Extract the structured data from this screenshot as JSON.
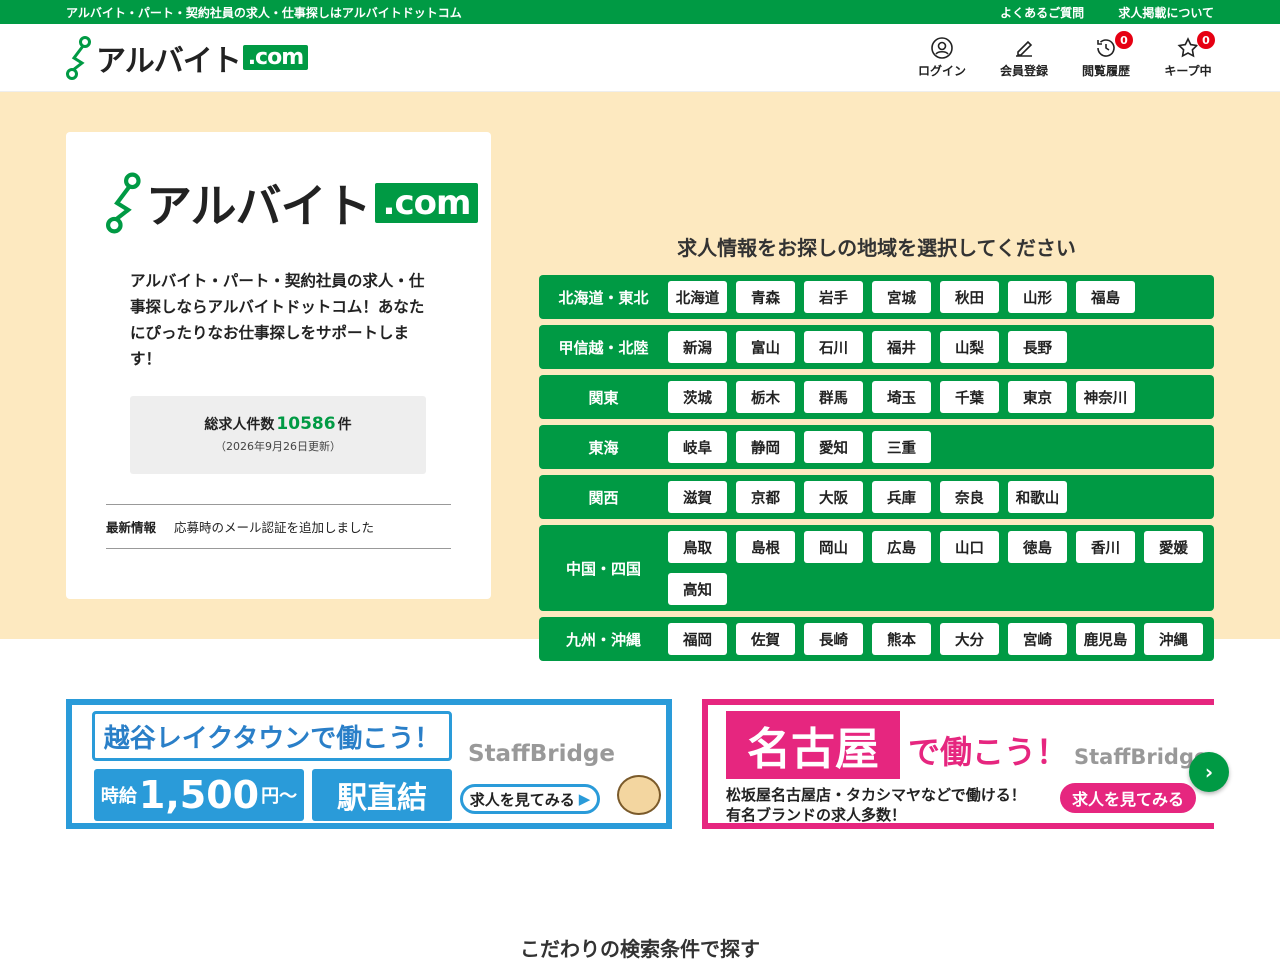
{
  "topbar": {
    "tagline": "アルバイト・パート・契約社員の求人・仕事探しはアルバイトドットコム",
    "links": [
      "よくあるご質問",
      "求人掲載について"
    ]
  },
  "header": {
    "logo_text": "アルバイト",
    "logo_com": ".com",
    "nav": [
      {
        "label": "ログイン",
        "icon": "user-icon"
      },
      {
        "label": "会員登録",
        "icon": "pencil-icon"
      },
      {
        "label": "閲覧履歴",
        "icon": "history-icon",
        "badge": "0"
      },
      {
        "label": "キープ中",
        "icon": "star-icon",
        "badge": "0"
      }
    ]
  },
  "card": {
    "logo_text": "アルバイト",
    "logo_com": ".com",
    "intro": "アルバイト・パート・契約社員の求人・仕事探しならアルバイトドットコム！あなたにぴったりなお仕事探しをサポートします！",
    "count_label": "総求人件数",
    "count_value": "10586",
    "count_unit": "件",
    "count_date": "（2026年9月26日更新）",
    "news_label": "最新情報",
    "news_text": "応募時のメール認証を追加しました"
  },
  "region_title": "求人情報をお探しの地域を選択してください",
  "regions": [
    {
      "name": "北海道・東北",
      "prefs": [
        "北海道",
        "青森",
        "岩手",
        "宮城",
        "秋田",
        "山形",
        "福島"
      ]
    },
    {
      "name": "甲信越・北陸",
      "prefs": [
        "新潟",
        "富山",
        "石川",
        "福井",
        "山梨",
        "長野"
      ]
    },
    {
      "name": "関東",
      "prefs": [
        "茨城",
        "栃木",
        "群馬",
        "埼玉",
        "千葉",
        "東京",
        "神奈川"
      ]
    },
    {
      "name": "東海",
      "prefs": [
        "岐阜",
        "静岡",
        "愛知",
        "三重"
      ]
    },
    {
      "name": "関西",
      "prefs": [
        "滋賀",
        "京都",
        "大阪",
        "兵庫",
        "奈良",
        "和歌山"
      ]
    },
    {
      "name": "中国・四国",
      "prefs": [
        "鳥取",
        "島根",
        "岡山",
        "広島",
        "山口",
        "徳島",
        "香川",
        "愛媛",
        "高知"
      ]
    },
    {
      "name": "九州・沖縄",
      "prefs": [
        "福岡",
        "佐賀",
        "長崎",
        "熊本",
        "大分",
        "宮崎",
        "鹿児島",
        "沖縄"
      ]
    }
  ],
  "banner1": {
    "headline": "越谷レイクタウンで働こう！",
    "wage_label": "時給",
    "wage_value": "1,500",
    "wage_unit": "円〜",
    "station": "駅直結",
    "brand": "StaffBridge",
    "button": "求人を見てみる"
  },
  "banner2": {
    "city": "名古屋",
    "headline": "で働こう！",
    "brand": "StaffBridge",
    "line1": "松坂屋名古屋店・タカシマヤなどで働ける！",
    "line2": "有名ブランドの求人多数！",
    "button": "求人を見てみる"
  },
  "section_title": "こだわりの検索条件で探す",
  "colors": {
    "brand_green": "#009a44",
    "hero_bg": "#fde9c0",
    "badge_red": "#e60012",
    "banner_blue": "#2a9bd9",
    "banner_pink": "#e6267f"
  }
}
